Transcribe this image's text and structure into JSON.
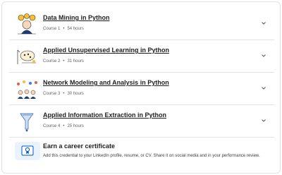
{
  "courses": [
    {
      "title": "Data Mining in Python",
      "course_label": "Course 1",
      "duration": "54 hours",
      "icon": "data-mining-illustration"
    },
    {
      "title": "Applied Unsupervised Learning in Python",
      "course_label": "Course 2",
      "duration": "31 hours",
      "icon": "unsupervised-learning-illustration"
    },
    {
      "title": "Network Modeling and Analysis in Python",
      "course_label": "Course 3",
      "duration": "30 hours",
      "icon": "network-modeling-illustration"
    },
    {
      "title": "Applied Information Extraction in Python",
      "course_label": "Course 4",
      "duration": "25 hours",
      "icon": "information-extraction-illustration"
    }
  ],
  "separator": "•",
  "certificate": {
    "title": "Earn a career certificate",
    "description": "Add this credential to your LinkedIn profile, resume, or CV. Share it on social media and in your performance review.",
    "icon": "certificate-icon"
  },
  "colors": {
    "accent": "#0056d2",
    "badge_bg": "#eaf2fb",
    "divider": "#e3e3e3"
  }
}
